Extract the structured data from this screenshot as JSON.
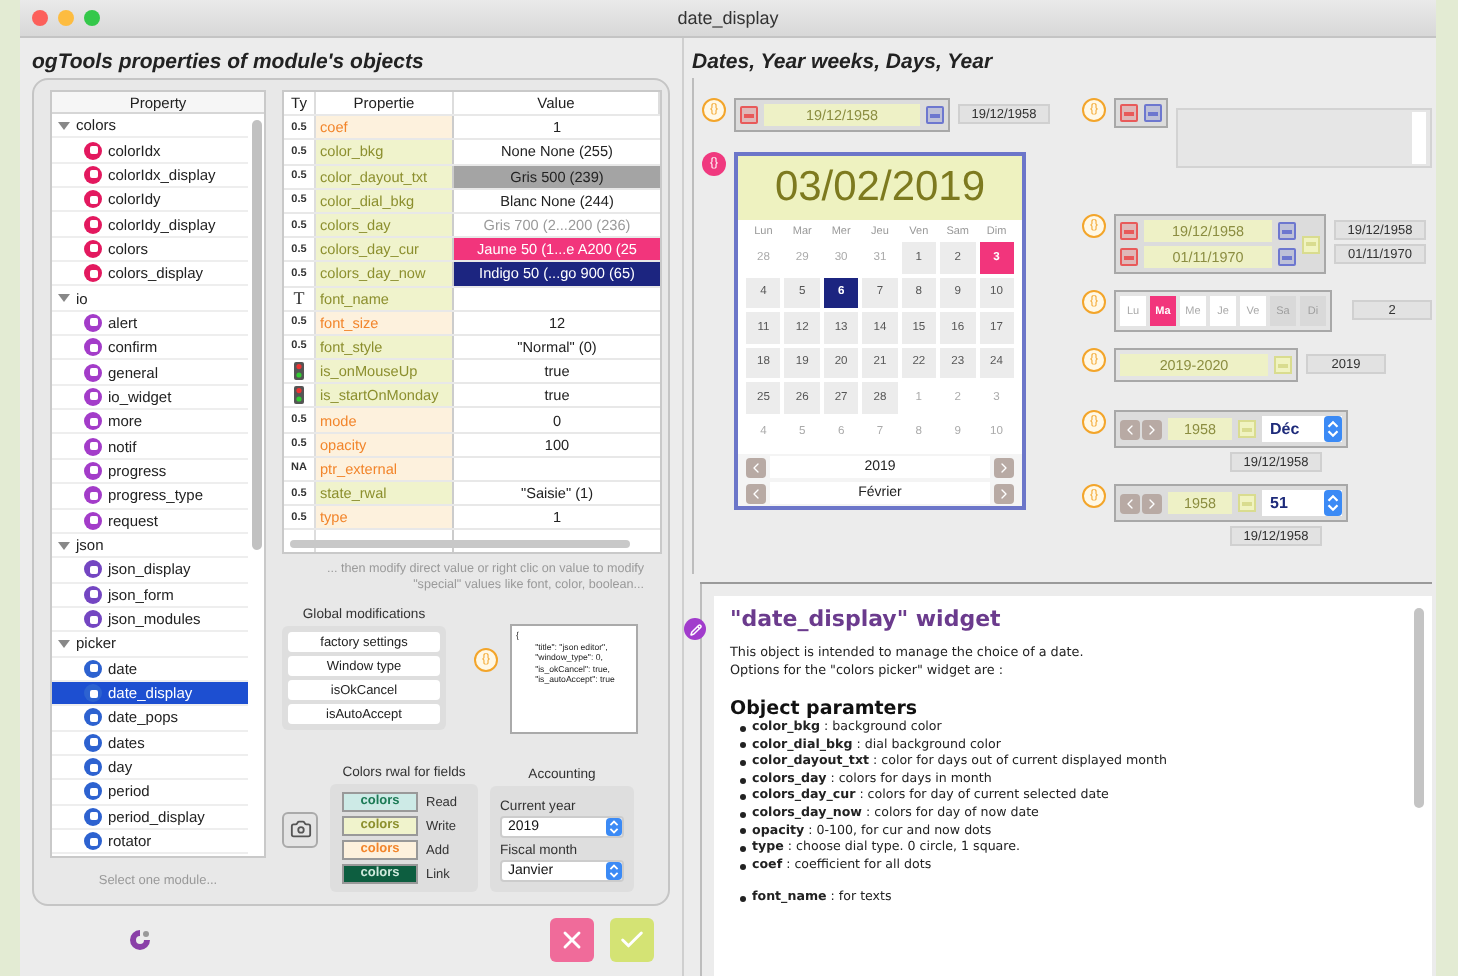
{
  "window": {
    "title": "date_display"
  },
  "left": {
    "heading": "ogTools properties of module's objects",
    "tree": {
      "header": "Property",
      "footer": "Select one module...",
      "groups": [
        {
          "label": "colors",
          "expanded": true,
          "color": "#e3195f",
          "children": [
            {
              "label": "colorIdx",
              "selected": false
            },
            {
              "label": "colorIdx_display",
              "selected": false
            },
            {
              "label": "colorIdy",
              "selected": false
            },
            {
              "label": "colorIdy_display",
              "selected": false
            },
            {
              "label": "colors",
              "selected": false
            },
            {
              "label": "colors_display",
              "selected": false
            }
          ]
        },
        {
          "label": "io",
          "expanded": true,
          "color": "#a33cc9",
          "children": [
            {
              "label": "alert",
              "selected": false
            },
            {
              "label": "confirm",
              "selected": false
            },
            {
              "label": "general",
              "selected": false
            },
            {
              "label": "io_widget",
              "selected": false
            },
            {
              "label": "more",
              "selected": false
            },
            {
              "label": "notif",
              "selected": false
            },
            {
              "label": "progress",
              "selected": false
            },
            {
              "label": "progress_type",
              "selected": false
            },
            {
              "label": "request",
              "selected": false
            }
          ]
        },
        {
          "label": "json",
          "expanded": true,
          "color": "#7446c2",
          "children": [
            {
              "label": "json_display",
              "selected": false
            },
            {
              "label": "json_form",
              "selected": false
            },
            {
              "label": "json_modules",
              "selected": false
            }
          ]
        },
        {
          "label": "picker",
          "expanded": true,
          "color": "#2d62d0",
          "children": [
            {
              "label": "date",
              "selected": false
            },
            {
              "label": "date_display",
              "selected": true
            },
            {
              "label": "date_pops",
              "selected": false
            },
            {
              "label": "dates",
              "selected": false
            },
            {
              "label": "day",
              "selected": false
            },
            {
              "label": "period",
              "selected": false
            },
            {
              "label": "period_display",
              "selected": false
            },
            {
              "label": "rotator",
              "selected": false
            }
          ]
        }
      ]
    },
    "properties": {
      "columns": [
        "Ty",
        "Propertie",
        "Value"
      ],
      "rows": [
        {
          "kind": "add",
          "type": {
            "kind": "number",
            "label": "0.5"
          },
          "name": "coef",
          "value": "1"
        },
        {
          "kind": "write",
          "type": {
            "kind": "number",
            "label": "0.5"
          },
          "name": "color_bkg",
          "value": "None None (255)"
        },
        {
          "kind": "write",
          "type": {
            "kind": "number",
            "label": "0.5"
          },
          "name": "color_dayout_txt",
          "value": "Gris 500 (239)",
          "color": "#a4a4a4"
        },
        {
          "kind": "write",
          "type": {
            "kind": "number",
            "label": "0.5"
          },
          "name": "color_dial_bkg",
          "value": "Blanc None (244)"
        },
        {
          "kind": "write",
          "type": {
            "kind": "number",
            "label": "0.5"
          },
          "name": "colors_day",
          "value": "Gris 700 (2...200 (236)",
          "color": "#ffffff"
        },
        {
          "kind": "write",
          "type": {
            "kind": "number",
            "label": "0.5"
          },
          "name": "colors_day_cur",
          "value": "Jaune 50 (1...e A200 (25",
          "color": "#f2357c"
        },
        {
          "kind": "write",
          "type": {
            "kind": "number",
            "label": "0.5"
          },
          "name": "colors_day_now",
          "value": "Indigo 50 (...go 900 (65)",
          "color": "#1c2580"
        },
        {
          "kind": "write",
          "type": {
            "kind": "text",
            "label": "T"
          },
          "name": "font_name"
        },
        {
          "kind": "add",
          "type": {
            "kind": "number",
            "label": "0.5"
          },
          "name": "font_size",
          "value": "12"
        },
        {
          "kind": "write",
          "type": {
            "kind": "number",
            "label": "0.5"
          },
          "name": "font_style",
          "value": "\"Normal\" (0)"
        },
        {
          "kind": "write",
          "type": {
            "kind": "boolean"
          },
          "name": "is_onMouseUp",
          "value": "true"
        },
        {
          "kind": "write",
          "type": {
            "kind": "boolean"
          },
          "name": "is_startOnMonday",
          "value": "true"
        },
        {
          "kind": "add",
          "type": {
            "kind": "number",
            "label": "0.5"
          },
          "name": "mode",
          "value": "0"
        },
        {
          "kind": "add",
          "type": {
            "kind": "number",
            "label": "0.5"
          },
          "name": "opacity",
          "value": "100"
        },
        {
          "kind": "add",
          "type": {
            "kind": "pointer",
            "label": "NA"
          },
          "name": "ptr_external"
        },
        {
          "kind": "write",
          "type": {
            "kind": "number",
            "label": "0.5"
          },
          "name": "state_rwal",
          "value": "\"Saisie\" (1)"
        },
        {
          "kind": "add",
          "type": {
            "kind": "number",
            "label": "0.5"
          },
          "name": "type",
          "value": "1"
        }
      ]
    },
    "hint": "... then modify direct value or right clic on value to modify \"special\" values like font, color, boolean...",
    "global_modifications": {
      "title": "Global modifications",
      "buttons": [
        "factory settings",
        "Window type",
        "isOkCancel",
        "isAutoAccept"
      ]
    },
    "json_editor": {
      "badge": {
        "text": "{}",
        "color": "#f3a52a"
      },
      "text": "{\n        \"title\": \"json editor\",\n        \"window_type\": 0,\n        \"is_okCancel\": true,\n        \"is_autoAccept\": true"
    },
    "colors_rwal": {
      "title": "Colors rwal for fields",
      "rows": [
        {
          "kind": "read",
          "swatch": "colors",
          "label": "Read"
        },
        {
          "kind": "write",
          "swatch": "colors",
          "label": "Write"
        },
        {
          "kind": "add",
          "swatch": "colors",
          "label": "Add"
        },
        {
          "kind": "link",
          "swatch": "colors",
          "label": "Link"
        }
      ]
    },
    "accounting": {
      "title": "Accounting",
      "fields": [
        {
          "label": "Current year",
          "value": "2019"
        },
        {
          "label": "Fiscal month",
          "value": "Janvier"
        }
      ]
    }
  },
  "right": {
    "heading": "Dates, Year weeks, Days, Year",
    "date_field": {
      "badge": {
        "text": "{}",
        "color": "#f3a52a"
      },
      "value": "19/12/1958",
      "output": "19/12/1958"
    },
    "calendar": {
      "badge": {
        "text": "{}",
        "color": "#f0397f"
      },
      "date": "03/02/2019",
      "weekdays": [
        "Lun",
        "Mar",
        "Mer",
        "Jeu",
        "Ven",
        "Sam",
        "Dim"
      ],
      "days": [
        {
          "label": "28",
          "in_month": false,
          "selected": false,
          "today": false
        },
        {
          "label": "29",
          "in_month": false,
          "selected": false,
          "today": false
        },
        {
          "label": "30",
          "in_month": false,
          "selected": false,
          "today": false
        },
        {
          "label": "31",
          "in_month": false,
          "selected": false,
          "today": false
        },
        {
          "label": "1",
          "in_month": true,
          "selected": false,
          "today": false
        },
        {
          "label": "2",
          "in_month": true,
          "selected": false,
          "today": false
        },
        {
          "label": "3",
          "in_month": true,
          "selected": true,
          "today": false
        },
        {
          "label": "4",
          "in_month": true,
          "selected": false,
          "today": false
        },
        {
          "label": "5",
          "in_month": true,
          "selected": false,
          "today": false
        },
        {
          "label": "6",
          "in_month": true,
          "selected": false,
          "today": true
        },
        {
          "label": "7",
          "in_month": true,
          "selected": false,
          "today": false
        },
        {
          "label": "8",
          "in_month": true,
          "selected": false,
          "today": false
        },
        {
          "label": "9",
          "in_month": true,
          "selected": false,
          "today": false
        },
        {
          "label": "10",
          "in_month": true,
          "selected": false,
          "today": false
        },
        {
          "label": "11",
          "in_month": true,
          "selected": false,
          "today": false
        },
        {
          "label": "12",
          "in_month": true,
          "selected": false,
          "today": false
        },
        {
          "label": "13",
          "in_month": true,
          "selected": false,
          "today": false
        },
        {
          "label": "14",
          "in_month": true,
          "selected": false,
          "today": false
        },
        {
          "label": "15",
          "in_month": true,
          "selected": false,
          "today": false
        },
        {
          "label": "16",
          "in_month": true,
          "selected": false,
          "today": false
        },
        {
          "label": "17",
          "in_month": true,
          "selected": false,
          "today": false
        },
        {
          "label": "18",
          "in_month": true,
          "selected": false,
          "today": false
        },
        {
          "label": "19",
          "in_month": true,
          "selected": false,
          "today": false
        },
        {
          "label": "20",
          "in_month": true,
          "selected": false,
          "today": false
        },
        {
          "label": "21",
          "in_month": true,
          "selected": false,
          "today": false
        },
        {
          "label": "22",
          "in_month": true,
          "selected": false,
          "today": false
        },
        {
          "label": "23",
          "in_month": true,
          "selected": false,
          "today": false
        },
        {
          "label": "24",
          "in_month": true,
          "selected": false,
          "today": false
        },
        {
          "label": "25",
          "in_month": true,
          "selected": false,
          "today": false
        },
        {
          "label": "26",
          "in_month": true,
          "selected": false,
          "today": false
        },
        {
          "label": "27",
          "in_month": true,
          "selected": false,
          "today": false
        },
        {
          "label": "28",
          "in_month": true,
          "selected": false,
          "today": false
        },
        {
          "label": "1",
          "in_month": false,
          "selected": false,
          "today": false
        },
        {
          "label": "2",
          "in_month": false,
          "selected": false,
          "today": false
        },
        {
          "label": "3",
          "in_month": false,
          "selected": false,
          "today": false
        },
        {
          "label": "4",
          "in_month": false,
          "selected": false,
          "today": false
        },
        {
          "label": "5",
          "in_month": false,
          "selected": false,
          "today": false
        },
        {
          "label": "6",
          "in_month": false,
          "selected": false,
          "today": false
        },
        {
          "label": "7",
          "in_month": false,
          "selected": false,
          "today": false
        },
        {
          "label": "8",
          "in_month": false,
          "selected": false,
          "today": false
        },
        {
          "label": "9",
          "in_month": false,
          "selected": false,
          "today": false
        },
        {
          "label": "10",
          "in_month": false,
          "selected": false,
          "today": false
        }
      ],
      "year": "2019",
      "month": "Février"
    },
    "widgets": [
      {
        "kind": "memo",
        "badge": {
          "text": "{}",
          "color": "#f3a52a"
        }
      },
      {
        "kind": "range",
        "badge": {
          "text": "{}",
          "color": "#f3a52a"
        },
        "values": [
          "19/12/1958",
          "01/11/1970"
        ],
        "outputs": [
          "19/12/1958",
          "01/11/1970"
        ]
      },
      {
        "kind": "days",
        "badge": {
          "text": "{}",
          "color": "#f3a52a"
        },
        "days": [
          {
            "label": "Lu",
            "selected": false,
            "disabled": false
          },
          {
            "label": "Ma",
            "selected": true,
            "disabled": false
          },
          {
            "label": "Me",
            "selected": false,
            "disabled": false
          },
          {
            "label": "Je",
            "selected": false,
            "disabled": false
          },
          {
            "label": "Ve",
            "selected": false,
            "disabled": false
          },
          {
            "label": "Sa",
            "selected": false,
            "disabled": true
          },
          {
            "label": "Di",
            "selected": false,
            "disabled": true
          }
        ],
        "output": "2"
      },
      {
        "kind": "period",
        "badge": {
          "text": "{}",
          "color": "#f3a52a"
        },
        "value": "2019-2020",
        "output": "2019"
      },
      {
        "kind": "rotator",
        "badge": {
          "text": "{}",
          "color": "#f3a52a"
        },
        "year": "1958",
        "select": "Déc",
        "output": "19/12/1958"
      },
      {
        "kind": "rotator",
        "badge": {
          "text": "{}",
          "color": "#f3a52a"
        },
        "year": "1958",
        "select": "51",
        "output": "19/12/1958"
      }
    ],
    "help": {
      "title": "\"date_display\" widget",
      "paragraph": [
        "This object is intended to manage the choice of a date.",
        "Options for the \"colors picker\" widget are :"
      ],
      "subtitle": "Object paramters",
      "items": [
        "**color_bkg** : background color",
        "**color_dial_bkg** : dial background color",
        "**color_dayout_txt** : color for days out of current displayed month",
        "**colors_day** : colors for days in month",
        "**colors_day_cur** : colors for day of current selected date",
        "**colors_day_now** : colors for day of now date",
        "**opacity** : 0-100, for cur and now dots",
        "**type** : choose dial type. 0 circle, 1 square.",
        "**coef** : coefficient for all dots"
      ],
      "items_more": [
        "**font_name** : for texts"
      ]
    }
  }
}
